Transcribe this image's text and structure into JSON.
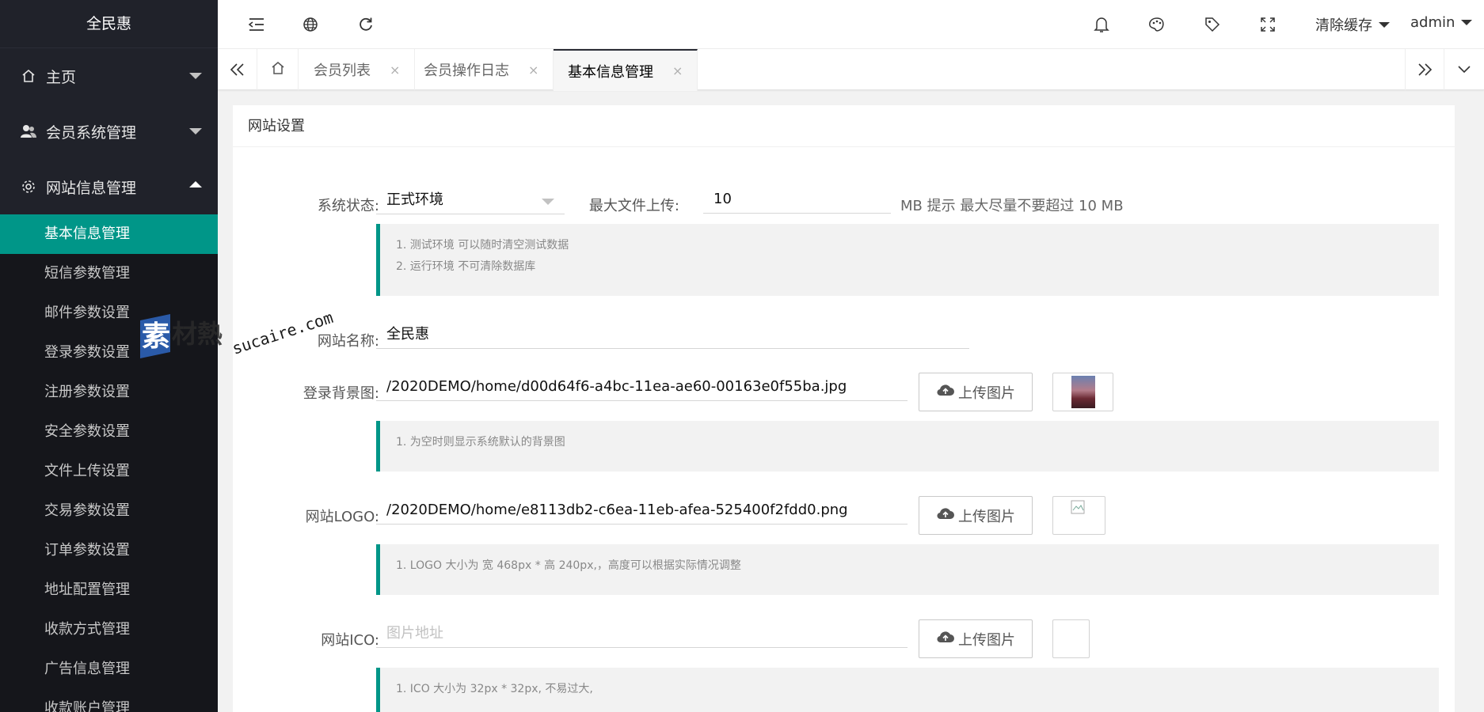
{
  "app": {
    "logo_text": "全民惠"
  },
  "sidebar": {
    "groups": [
      {
        "label": "主页",
        "icon": "home-icon"
      },
      {
        "label": "会员系统管理",
        "icon": "users-icon"
      },
      {
        "label": "网站信息管理",
        "icon": "gear-icon"
      }
    ],
    "sub_items": [
      "基本信息管理",
      "短信参数管理",
      "邮件参数设置",
      "登录参数设置",
      "注册参数设置",
      "安全参数设置",
      "文件上传设置",
      "交易参数设置",
      "订单参数设置",
      "地址配置管理",
      "收款方式管理",
      "广告信息管理",
      "收款账户管理"
    ],
    "active_sub": "基本信息管理"
  },
  "header": {
    "icons": [
      "menu-collapse-icon",
      "globe-icon",
      "refresh-icon",
      "bell-icon",
      "palette-icon",
      "tag-icon",
      "fullscreen-icon"
    ],
    "clear_cache": "清除缓存",
    "user": "admin"
  },
  "tabs": {
    "items": [
      {
        "label": "会员列表"
      },
      {
        "label": "会员操作日志"
      },
      {
        "label": "基本信息管理",
        "active": true
      }
    ],
    "close_glyph": "×"
  },
  "form": {
    "title": "网站设置",
    "system_status": {
      "label": "系统状态:",
      "value": "正式环境"
    },
    "max_upload": {
      "label": "最大文件上传:",
      "value": "10",
      "suffix": "MB 提示 最大尽量不要超过 10 MB"
    },
    "status_tips": [
      "1. 测试环境 可以随时清空测试数据",
      "2. 运行环境 不可清除数据库"
    ],
    "site_name": {
      "label": "网站名称:",
      "value": "全民惠"
    },
    "login_bg": {
      "label": "登录背景图:",
      "value": "/2020DEMO/home/d00d64f6-a4bc-11ea-ae60-00163e0f55ba.jpg",
      "button": "上传图片",
      "tip": "1. 为空时则显示系统默认的背景图"
    },
    "site_logo": {
      "label": "网站LOGO:",
      "value": "/2020DEMO/home/e8113db2-c6ea-11eb-afea-525400f2fdd0.png",
      "button": "上传图片",
      "tip": "1. LOGO 大小为 宽 468px * 高 240px,，高度可以根据实际情况调整"
    },
    "site_ico": {
      "label": "网站ICO:",
      "placeholder": "图片地址",
      "button": "上传图片",
      "tip": "1. ICO 大小为 32px * 32px, 不易过大,"
    }
  },
  "watermark": {
    "text_cn": "素材熱",
    "text_en": "sucaire.com"
  },
  "colors": {
    "accent": "#009688",
    "sidebar_bg": "#20222a",
    "sub_bg": "#15161b"
  }
}
